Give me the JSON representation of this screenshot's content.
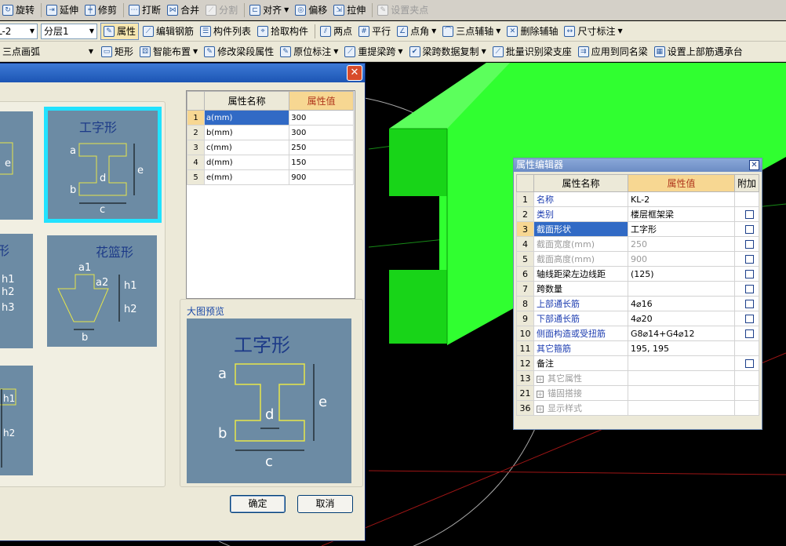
{
  "toolbar_row1": [
    "旋转",
    "延伸",
    "修剪",
    "打断",
    "合并",
    "分割",
    "对齐",
    "偏移",
    "拉伸",
    "设置夹点"
  ],
  "toolbar_row2": {
    "element_combo": "L-2",
    "floor_combo": "分层1",
    "buttons": [
      "属性",
      "编辑钢筋",
      "构件列表",
      "拾取构件",
      "两点",
      "平行",
      "点角",
      "三点辅轴",
      "删除辅轴",
      "尺寸标注"
    ]
  },
  "toolbar_row3": {
    "arc_combo": "三点画弧",
    "buttons": [
      "矩形",
      "智能布置",
      "修改梁段属性",
      "原位标注",
      "重提梁跨",
      "梁跨数据复制",
      "批量识别梁支座",
      "应用到同名梁",
      "设置上部筋遇承台"
    ]
  },
  "dialog": {
    "close_glyph": "✕",
    "shapes": [
      {
        "title": "工字形",
        "labels": [
          "a",
          "b",
          "c",
          "d",
          "e"
        ]
      },
      {
        "title": "花篮形",
        "labels": [
          "a1",
          "a2",
          "h1",
          "h2",
          "b"
        ]
      },
      {
        "title": "形",
        "labels": [
          "h1",
          "h2",
          "h3"
        ]
      },
      {
        "title": "",
        "labels": [
          "h1",
          "h2"
        ]
      }
    ],
    "grid": {
      "headers": [
        "属性名称",
        "属性值"
      ],
      "rows": [
        {
          "n": "1",
          "name": "a(mm)",
          "value": "300"
        },
        {
          "n": "2",
          "name": "b(mm)",
          "value": "300"
        },
        {
          "n": "3",
          "name": "c(mm)",
          "value": "250"
        },
        {
          "n": "4",
          "name": "d(mm)",
          "value": "150"
        },
        {
          "n": "5",
          "name": "e(mm)",
          "value": "900"
        }
      ]
    },
    "preview_label": "大图预览",
    "preview_title": "工字形",
    "preview_labels": [
      "a",
      "b",
      "c",
      "d",
      "e"
    ],
    "ok_label": "确定",
    "cancel_label": "取消"
  },
  "attr_editor": {
    "title": "属性编辑器",
    "close_glyph": "✕",
    "headers": [
      "属性名称",
      "属性值",
      "附加"
    ],
    "rows": [
      {
        "n": "1",
        "name": "名称",
        "value": "KL-2",
        "style": "blue",
        "chk": false
      },
      {
        "n": "2",
        "name": "类别",
        "value": "楼层框架梁",
        "style": "blue",
        "chk": true
      },
      {
        "n": "3",
        "name": "截面形状",
        "value": "工字形",
        "style": "sel",
        "chk": true
      },
      {
        "n": "4",
        "name": "截面宽度(mm)",
        "value": "250",
        "style": "grey",
        "chk": true
      },
      {
        "n": "5",
        "name": "截面高度(mm)",
        "value": "900",
        "style": "grey",
        "chk": true
      },
      {
        "n": "6",
        "name": "轴线距梁左边线距",
        "value": "(125)",
        "style": "",
        "chk": true
      },
      {
        "n": "7",
        "name": "跨数量",
        "value": "",
        "style": "",
        "chk": true
      },
      {
        "n": "8",
        "name": "上部通长筋",
        "value": "4⌀16",
        "style": "blue",
        "chk": true
      },
      {
        "n": "9",
        "name": "下部通长筋",
        "value": "4⌀20",
        "style": "blue",
        "chk": true
      },
      {
        "n": "10",
        "name": "侧面构造或受扭筋",
        "value": "G8⌀14+G4⌀12",
        "style": "blue",
        "chk": true
      },
      {
        "n": "11",
        "name": "其它箍筋",
        "value": "195, 195",
        "style": "blue",
        "chk": false
      },
      {
        "n": "12",
        "name": "备注",
        "value": "",
        "style": "",
        "chk": true
      },
      {
        "n": "13",
        "name": "其它属性",
        "value": "",
        "style": "group",
        "chk": false
      },
      {
        "n": "21",
        "name": "锚固搭接",
        "value": "",
        "style": "group",
        "chk": false
      },
      {
        "n": "36",
        "name": "显示样式",
        "value": "",
        "style": "group",
        "chk": false
      }
    ]
  },
  "colors": {
    "beam": "#22e222",
    "canvas": "#000000",
    "panel": "#ece9d8",
    "shape_bg": "#6c8ba4",
    "highlight": "#316ac5",
    "header_val": "#f7d792"
  }
}
